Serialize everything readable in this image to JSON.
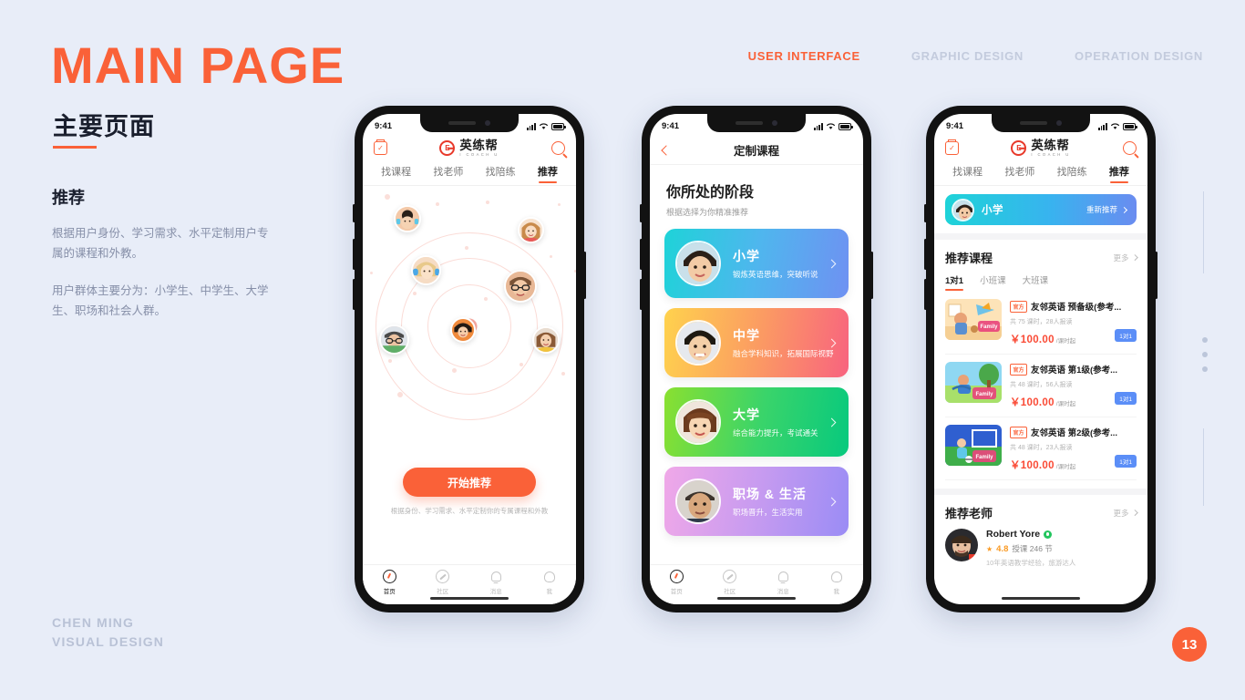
{
  "slide": {
    "title_en": "MAIN PAGE",
    "title_cn": "主要页面",
    "section_heading": "推荐",
    "paragraph_1": "根据用户身份、学习需求、水平定制用户专属的课程和外教。",
    "paragraph_2": "用户群体主要分为：小学生、中学生、大学生、职场和社会人群。",
    "credit_line1": "CHEN MING",
    "credit_line2": "VISUAL DESIGN",
    "page_number": "13",
    "accent_color": "#fa6138",
    "background_color": "#e8edf8"
  },
  "topnav": {
    "items": [
      {
        "label": "USER INTERFACE",
        "active": true
      },
      {
        "label": "GRAPHIC DESIGN",
        "active": false
      },
      {
        "label": "OPERATION DESIGN",
        "active": false
      }
    ]
  },
  "status_bar": {
    "time": "9:41"
  },
  "app": {
    "brand_name": "英练帮",
    "brand_sub": "I COACH U",
    "tabs": [
      {
        "label": "找课程",
        "active": false
      },
      {
        "label": "找老师",
        "active": false
      },
      {
        "label": "找陪练",
        "active": false
      },
      {
        "label": "推荐",
        "active": true
      }
    ],
    "bottom_nav": [
      {
        "label": "首页",
        "icon": "home-icon",
        "active": true
      },
      {
        "label": "社区",
        "icon": "compass-icon",
        "active": false
      },
      {
        "label": "消息",
        "icon": "bell-icon",
        "active": false
      },
      {
        "label": "我",
        "icon": "person-icon",
        "active": false
      }
    ]
  },
  "screen1": {
    "cta_label": "开始推荐",
    "cta_note": "根据身份、学习需求、水平定制你的专属课程和外教"
  },
  "screen2": {
    "nav_title": "定制课程",
    "heading": "你所处的阶段",
    "subheading": "根据选择为你精准推荐",
    "stages": [
      {
        "title": "小学",
        "desc": "锻炼英语思维，突破听说",
        "color_from": "#1ed3d8",
        "color_to": "#6a8cf0"
      },
      {
        "title": "中学",
        "desc": "融合学科知识，拓展国际视野",
        "color_from": "#ffd24d",
        "color_to": "#f8637f"
      },
      {
        "title": "大学",
        "desc": "综合能力提升，考试通关",
        "color_from": "#8ae030",
        "color_to": "#07c97e"
      },
      {
        "title": "职场 & 生活",
        "desc": "职场晋升，生活实用",
        "color_from": "#f0a8e8",
        "color_to": "#9a8cf5"
      }
    ]
  },
  "screen3": {
    "banner": {
      "stage": "小学",
      "action": "重新推荐"
    },
    "courses_section": {
      "title": "推荐课程",
      "more": "更多"
    },
    "course_tabs": [
      {
        "label": "1对1",
        "active": true
      },
      {
        "label": "小班课",
        "active": false
      },
      {
        "label": "大班课",
        "active": false
      }
    ],
    "courses": [
      {
        "badge": "官方",
        "name": "友邻英语 预备级(参考...",
        "meta": "共 75 课时，28人报读",
        "price": "￥100.00",
        "price_unit": "/课时起",
        "tag": "1对1",
        "thumb_from": "#ffd9a0",
        "thumb_to": "#ffe9c4"
      },
      {
        "badge": "官方",
        "name": "友邻英语 第1级(参考...",
        "meta": "共 48 课时，56人报读",
        "price": "￥100.00",
        "price_unit": "/课时起",
        "tag": "1对1",
        "thumb_from": "#7fd4f0",
        "thumb_to": "#a8e86a"
      },
      {
        "badge": "官方",
        "name": "友邻英语 第2级(参考...",
        "meta": "共 48 课时，23人报读",
        "price": "￥100.00",
        "price_unit": "/课时起",
        "tag": "1对1",
        "thumb_from": "#2f5fd0",
        "thumb_to": "#3fae4a"
      }
    ],
    "teachers_section": {
      "title": "推荐老师",
      "more": "更多"
    },
    "teacher": {
      "name": "Robert Yore",
      "rating": "4.8",
      "lessons": "授课 246 节",
      "desc": "10年英语教学经验，旅游达人",
      "flag": "canada-flag-icon"
    }
  }
}
